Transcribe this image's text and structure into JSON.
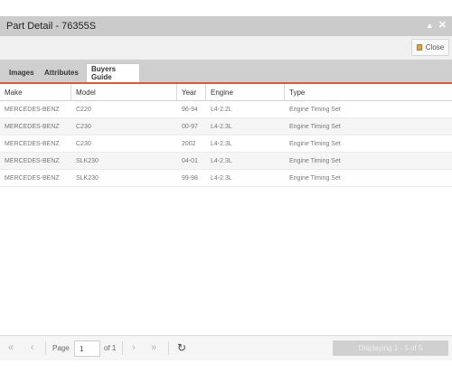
{
  "window": {
    "title": "Part Detail - 76355S",
    "minimize_icon": "caret-up-icon",
    "close_icon": "x-icon"
  },
  "toolbar": {
    "close_label": "Close"
  },
  "tabs": [
    {
      "label": "Images"
    },
    {
      "label": "Attributes"
    },
    {
      "label": "Buyers Guide",
      "active": true
    }
  ],
  "grid": {
    "columns": [
      "Make",
      "Model",
      "Year",
      "Engine",
      "Type"
    ],
    "rows": [
      [
        "MERCEDES-BENZ",
        "C220",
        "96-94",
        "L4-2.2L",
        "Engine Timing Set"
      ],
      [
        "MERCEDES-BENZ",
        "C230",
        "00-97",
        "L4-2.3L",
        "Engine Timing Set"
      ],
      [
        "MERCEDES-BENZ",
        "C230",
        "2002",
        "L4-2.3L",
        "Engine Timing Set"
      ],
      [
        "MERCEDES-BENZ",
        "SLK230",
        "04-01",
        "L4-2.3L",
        "Engine Timing Set"
      ],
      [
        "MERCEDES-BENZ",
        "SLK230",
        "99-98",
        "L4-2.3L",
        "Engine Timing Set"
      ]
    ]
  },
  "pager": {
    "page_label": "Page",
    "page_value": "1",
    "of_label": "of 1",
    "display_info": "Displaying 1 - 5 of 5"
  },
  "colors": {
    "accent": "#d75c37",
    "titlebar": "#cbcbcb",
    "tabbar": "#cfcfcf"
  }
}
